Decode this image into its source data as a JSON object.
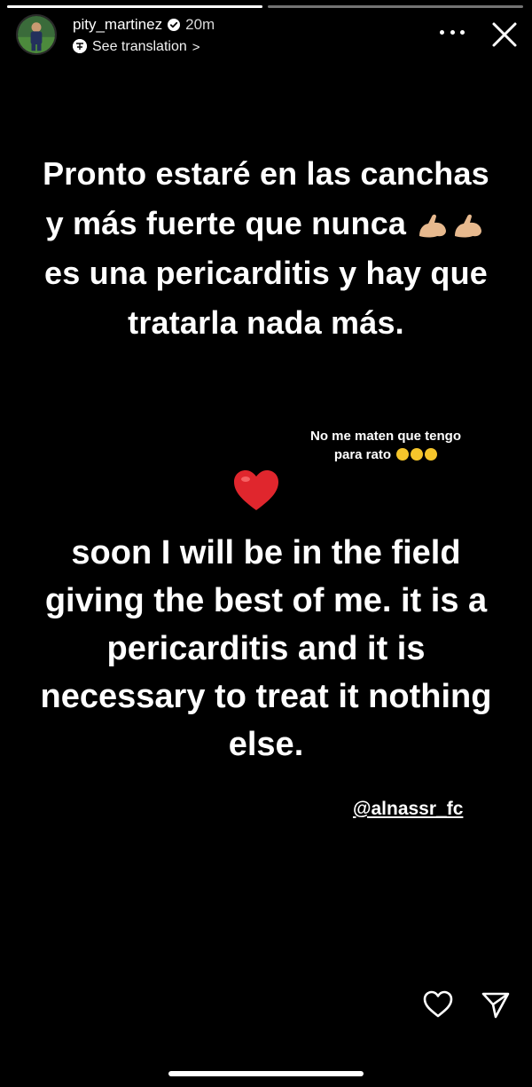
{
  "story": {
    "progress": [
      1.0,
      0.0
    ]
  },
  "header": {
    "username": "pity_martinez",
    "verified_icon": "verified-badge-icon",
    "time_ago": "20m",
    "translation_label": "See translation",
    "translation_chevron": ">",
    "more_icon": "more-horizontal-icon",
    "close_icon": "close-icon"
  },
  "captions": {
    "spanish_part1": "Pronto estaré en las canchas y más fuerte que nunca",
    "spanish_part2": "es una pericarditis y hay que tratarla nada más.",
    "joke_line1": "No me maten que tengo",
    "joke_line2": "para rato",
    "english": "soon I will be in the field giving the best of me.  it is a pericarditis and it is necessary to treat it nothing else.",
    "mention": "@alnassr_fc"
  },
  "colors": {
    "background": "#000000",
    "heart": "#e0262d",
    "muscle_emoji": "#e7b98e",
    "laugh_emoji": "#f5c52b"
  },
  "footer": {
    "like_icon": "heart-outline-icon",
    "send_icon": "send-icon"
  }
}
